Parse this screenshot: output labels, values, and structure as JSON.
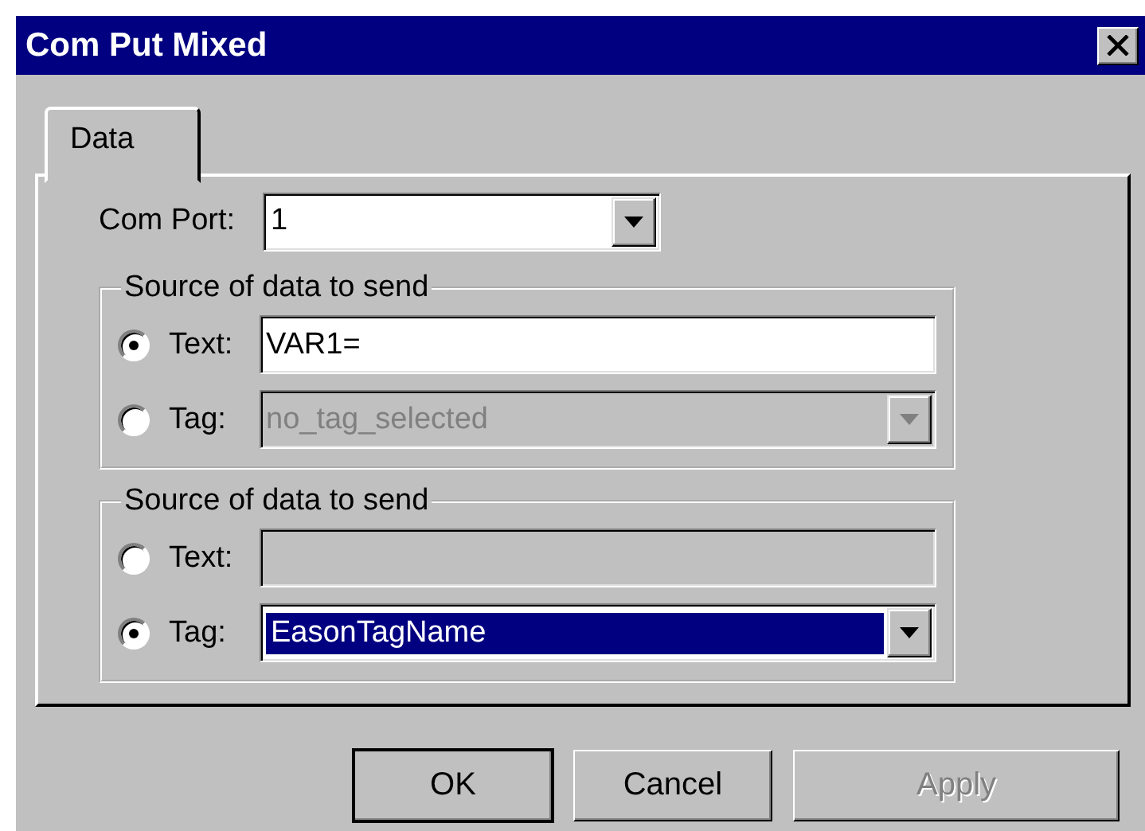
{
  "window": {
    "title": "Com Put Mixed"
  },
  "tabs": [
    {
      "label": "Data",
      "selected": true
    }
  ],
  "com_port": {
    "label": "Com Port:",
    "value": "1"
  },
  "groups": [
    {
      "title": "Source of data to send",
      "options": [
        {
          "kind": "text",
          "label": "Text:",
          "selected": true,
          "disabled": false,
          "value": "VAR1="
        },
        {
          "kind": "tag",
          "label": "Tag:",
          "selected": false,
          "disabled": true,
          "value": "no_tag_selected",
          "focused": false
        }
      ]
    },
    {
      "title": "Source of data to send",
      "options": [
        {
          "kind": "text",
          "label": "Text:",
          "selected": false,
          "disabled": true
        },
        {
          "kind": "tag",
          "label": "Tag:",
          "selected": true,
          "disabled": false,
          "value": "EasonTagName",
          "focused": true
        }
      ]
    }
  ],
  "buttons": [
    {
      "label": "OK",
      "default": true,
      "disabled": false
    },
    {
      "label": "Cancel",
      "default": false,
      "disabled": false
    },
    {
      "label": "Apply",
      "default": false,
      "disabled": true
    }
  ]
}
